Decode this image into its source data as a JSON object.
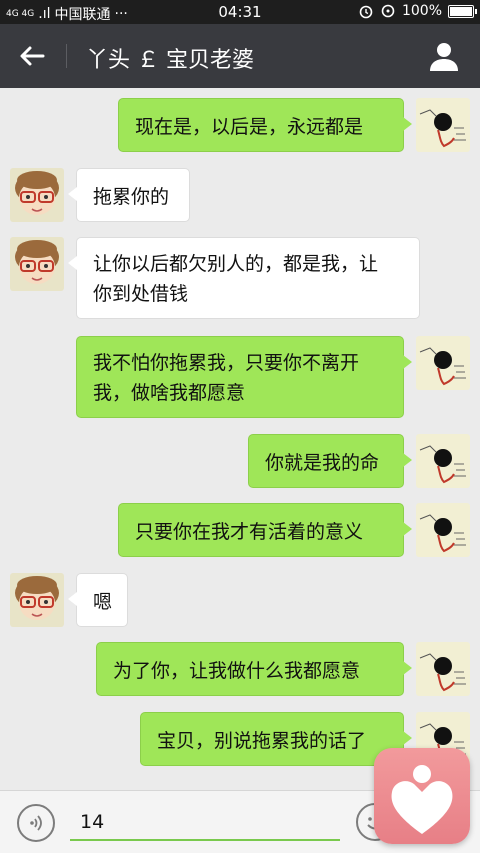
{
  "status_bar": {
    "network_small": "4G 4G",
    "signal_text": ".ıl",
    "carrier": "中国联通",
    "more": "···",
    "time": "04:31",
    "battery": "100%"
  },
  "header": {
    "title": "丫头 ￡ 宝贝老婆",
    "back_icon": "back-arrow-icon",
    "profile_icon": "person-icon"
  },
  "messages": [
    {
      "side": "out",
      "text": "现在是，以后是，永远都是"
    },
    {
      "side": "in",
      "text": "拖累你的"
    },
    {
      "side": "in",
      "line1": "让你以后都欠别人的，都是我，让",
      "line2": "你到处借钱"
    },
    {
      "side": "out",
      "line1": "我不怕你拖累我，只要你不离开",
      "line2": "我，做啥我都愿意"
    },
    {
      "side": "out",
      "text": "你就是我的命"
    },
    {
      "side": "out",
      "text": "只要你在我才有活着的意义"
    },
    {
      "side": "in",
      "text": "嗯"
    },
    {
      "side": "out",
      "text": "为了你，让我做什么我都愿意"
    },
    {
      "side": "out",
      "text": "宝贝，别说拖累我的话了"
    }
  ],
  "input": {
    "value": "14"
  },
  "colors": {
    "outgoing_bubble": "#9fe658",
    "incoming_bubble": "#ffffff",
    "chat_bg": "#ebebeb",
    "titlebar": "#393a3f"
  }
}
